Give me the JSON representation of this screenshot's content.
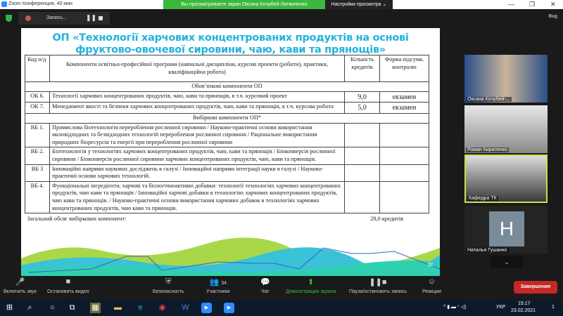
{
  "window": {
    "title": "Zoom Конференция, 40 мин",
    "minimize": "—",
    "maximize": "❐",
    "close": "✕"
  },
  "share_banner": {
    "text": "Вы просматриваете экран Оксана Кочубей-Литвиненко",
    "settings": "Настройки просмотра ⌄"
  },
  "recording": {
    "label": "Запись...",
    "view": "Вид"
  },
  "slide": {
    "title": "ОП «Технології харчових концентрованих продуктів на основі фруктово-овочевої сировини, чаю, кави та прянощів»",
    "headers": {
      "code": "Код н/д",
      "component": "Компоненти освітньо-професійної програми (навчальні дисципліни, курсові проекти (роботи), практики, кваліфікаційна робота)",
      "credits": "Кількість кредитів",
      "form": "Форма підсумк. контролю"
    },
    "section_mandatory": "Обов’язкові компоненти ОП",
    "mandatory": [
      {
        "code": "ОК 6.",
        "name": "Технології харчових концентрованих продуктів, чаю, кави та прянощів, в т.ч. курсовий проект",
        "credits": "9,0",
        "form": "екзамен"
      },
      {
        "code": "ОК 7.",
        "name": "Менеджмент якості та безпеки харчових концентрованих продуктів, чаю, кави та прянощів, в т.ч. курсова робота",
        "credits": "5,0",
        "form": "екзамен"
      }
    ],
    "section_elective": "Вибіркові компоненти ОП*",
    "elective": [
      {
        "code": "ВБ 1.",
        "name": "Промислова біотехнологія перероблення рослинної сировини /  Науково-практичні основи використання маловідходних та безвідходних технологій перероблення рослинної сировини / Раціональне використання природних біоресурсів та енергії при перероблення рослинної сировини"
      },
      {
        "code": "ВБ 2.",
        "name": "Біотехнологія у технологіях харчових концентрованих продуктів, чаю, кави та прянощів / Біоконверсія рослинної сировини / Біоконверсія рослинної сировини харчових концентрованих продуктів, чаю, кави та прянощів."
      },
      {
        "code": "ВБ 3",
        "name": "Інноваційні напрями наукових досліджень в галузі / Інноваційні напрями інтеграції науки в галузі / Науково-практичні основи харчових технологій."
      },
      {
        "code": "ВБ 4.",
        "name": "Функціональні інгредієнти, харчові та біологічноактивні добавки: технології технологіях харчових концентрованих продуктів, чаю кави та прянощів / Інноваційні харчові добавки в технологіях харчових концентрованих продуктів, чаю кави та прянощів. / Науково-практичні основи використання харчових добавок в технологіях харчових концентрованих продуктів, чаю кави та прянощів."
      }
    ],
    "total_label": "Загальний обсяг вибіркових компонент:",
    "total_value": "28,0 кредитів",
    "page_number": "32"
  },
  "participants": [
    {
      "name": "Оксана Кочубей-...",
      "muted": true
    },
    {
      "name": "Роман Кириленко",
      "muted": true
    },
    {
      "name": "Кафедра ТК",
      "muted": false,
      "active_speaker": true
    },
    {
      "name": "Наталья Гушанко",
      "muted": true,
      "avatar_letter": "Н"
    }
  ],
  "toolbar": {
    "audio": "Включить звук",
    "video": "Остановить видео",
    "security": "Безопасность",
    "participants": "Участники",
    "participants_count": "34",
    "chat": "Чат",
    "share": "Демонстрация экрана",
    "record": "Пауза/остановить запись",
    "reactions": "Реакции",
    "end": "Завершение"
  },
  "taskbar": {
    "language": "УКР",
    "time": "15:17",
    "date": "23.02.2021",
    "notifications": "1"
  }
}
